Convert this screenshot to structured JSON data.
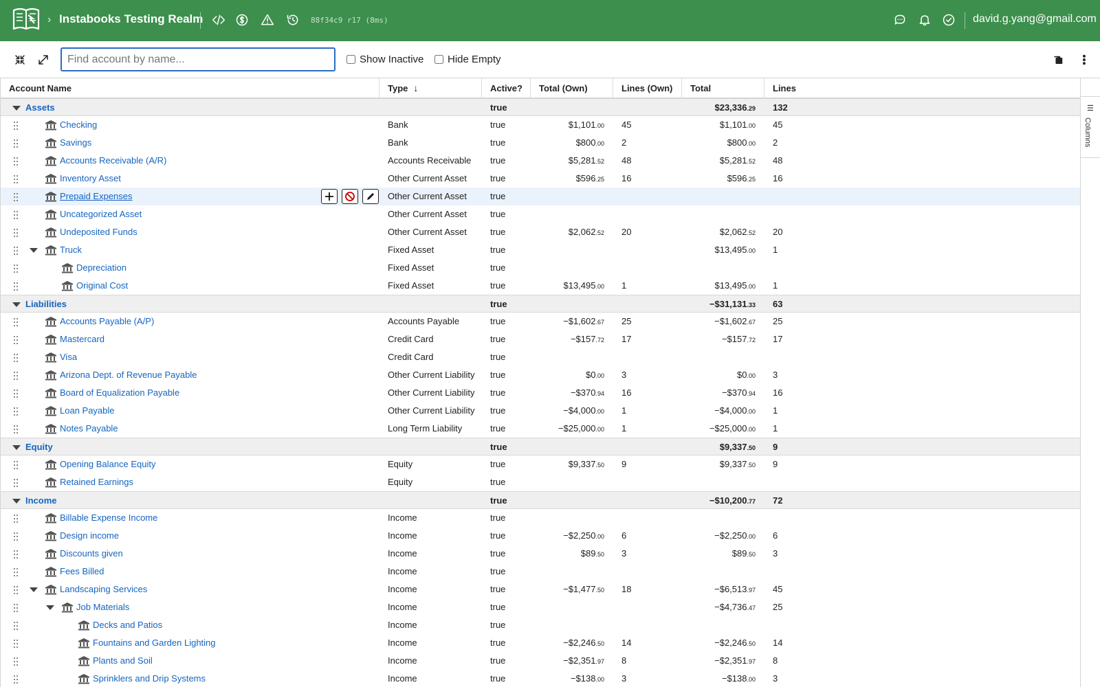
{
  "header": {
    "realm": "Instabooks Testing Realm",
    "build": "88f34c9 r17 (8ms)",
    "user": "david.g.yang@gmail.com"
  },
  "toolbar": {
    "search_placeholder": "Find account by name...",
    "show_inactive": "Show Inactive",
    "hide_empty": "Hide Empty"
  },
  "columns": [
    "Account Name",
    "Type",
    "Active?",
    "Total (Own)",
    "Lines (Own)",
    "Total",
    "Lines"
  ],
  "side_panel": {
    "columns_label": "Columns"
  },
  "rows": [
    {
      "group": true,
      "name": "Assets",
      "active": "true",
      "total_main": "$23,336",
      "total_cents": ".29",
      "lines": "132"
    },
    {
      "level": 1,
      "name": "Checking",
      "type": "Bank",
      "active": "true",
      "own_main": "$1,101",
      "own_cents": ".00",
      "lines_own": "45",
      "total_main": "$1,101",
      "total_cents": ".00",
      "lines": "45"
    },
    {
      "level": 1,
      "name": "Savings",
      "type": "Bank",
      "active": "true",
      "own_main": "$800",
      "own_cents": ".00",
      "lines_own": "2",
      "total_main": "$800",
      "total_cents": ".00",
      "lines": "2"
    },
    {
      "level": 1,
      "name": "Accounts Receivable (A/R)",
      "type": "Accounts Receivable",
      "active": "true",
      "own_main": "$5,281",
      "own_cents": ".52",
      "lines_own": "48",
      "total_main": "$5,281",
      "total_cents": ".52",
      "lines": "48"
    },
    {
      "level": 1,
      "name": "Inventory Asset",
      "type": "Other Current Asset",
      "active": "true",
      "own_main": "$596",
      "own_cents": ".25",
      "lines_own": "16",
      "total_main": "$596",
      "total_cents": ".25",
      "lines": "16"
    },
    {
      "level": 1,
      "name": "Prepaid Expenses",
      "type": "Other Current Asset",
      "active": "true",
      "hover": true
    },
    {
      "level": 1,
      "name": "Uncategorized Asset",
      "type": "Other Current Asset",
      "active": "true"
    },
    {
      "level": 1,
      "name": "Undeposited Funds",
      "type": "Other Current Asset",
      "active": "true",
      "own_main": "$2,062",
      "own_cents": ".52",
      "lines_own": "20",
      "total_main": "$2,062",
      "total_cents": ".52",
      "lines": "20"
    },
    {
      "level": 1,
      "name": "Truck",
      "type": "Fixed Asset",
      "active": "true",
      "expandable": true,
      "total_main": "$13,495",
      "total_cents": ".00",
      "lines": "1"
    },
    {
      "level": 2,
      "name": "Depreciation",
      "type": "Fixed Asset",
      "active": "true"
    },
    {
      "level": 2,
      "name": "Original Cost",
      "type": "Fixed Asset",
      "active": "true",
      "own_main": "$13,495",
      "own_cents": ".00",
      "lines_own": "1",
      "total_main": "$13,495",
      "total_cents": ".00",
      "lines": "1"
    },
    {
      "group": true,
      "name": "Liabilities",
      "active": "true",
      "total_main": "−$31,131",
      "total_cents": ".33",
      "lines": "63"
    },
    {
      "level": 1,
      "name": "Accounts Payable (A/P)",
      "type": "Accounts Payable",
      "active": "true",
      "own_main": "−$1,602",
      "own_cents": ".67",
      "lines_own": "25",
      "total_main": "−$1,602",
      "total_cents": ".67",
      "lines": "25"
    },
    {
      "level": 1,
      "name": "Mastercard",
      "type": "Credit Card",
      "active": "true",
      "own_main": "−$157",
      "own_cents": ".72",
      "lines_own": "17",
      "total_main": "−$157",
      "total_cents": ".72",
      "lines": "17"
    },
    {
      "level": 1,
      "name": "Visa",
      "type": "Credit Card",
      "active": "true"
    },
    {
      "level": 1,
      "name": "Arizona Dept. of Revenue Payable",
      "type": "Other Current Liability",
      "active": "true",
      "own_main": "$0",
      "own_cents": ".00",
      "lines_own": "3",
      "total_main": "$0",
      "total_cents": ".00",
      "lines": "3"
    },
    {
      "level": 1,
      "name": "Board of Equalization Payable",
      "type": "Other Current Liability",
      "active": "true",
      "own_main": "−$370",
      "own_cents": ".94",
      "lines_own": "16",
      "total_main": "−$370",
      "total_cents": ".94",
      "lines": "16"
    },
    {
      "level": 1,
      "name": "Loan Payable",
      "type": "Other Current Liability",
      "active": "true",
      "own_main": "−$4,000",
      "own_cents": ".00",
      "lines_own": "1",
      "total_main": "−$4,000",
      "total_cents": ".00",
      "lines": "1"
    },
    {
      "level": 1,
      "name": "Notes Payable",
      "type": "Long Term Liability",
      "active": "true",
      "own_main": "−$25,000",
      "own_cents": ".00",
      "lines_own": "1",
      "total_main": "−$25,000",
      "total_cents": ".00",
      "lines": "1"
    },
    {
      "group": true,
      "name": "Equity",
      "active": "true",
      "total_main": "$9,337",
      "total_cents": ".50",
      "lines": "9"
    },
    {
      "level": 1,
      "name": "Opening Balance Equity",
      "type": "Equity",
      "active": "true",
      "own_main": "$9,337",
      "own_cents": ".50",
      "lines_own": "9",
      "total_main": "$9,337",
      "total_cents": ".50",
      "lines": "9"
    },
    {
      "level": 1,
      "name": "Retained Earnings",
      "type": "Equity",
      "active": "true"
    },
    {
      "group": true,
      "name": "Income",
      "active": "true",
      "total_main": "−$10,200",
      "total_cents": ".77",
      "lines": "72"
    },
    {
      "level": 1,
      "name": "Billable Expense Income",
      "type": "Income",
      "active": "true"
    },
    {
      "level": 1,
      "name": "Design income",
      "type": "Income",
      "active": "true",
      "own_main": "−$2,250",
      "own_cents": ".00",
      "lines_own": "6",
      "total_main": "−$2,250",
      "total_cents": ".00",
      "lines": "6"
    },
    {
      "level": 1,
      "name": "Discounts given",
      "type": "Income",
      "active": "true",
      "own_main": "$89",
      "own_cents": ".50",
      "lines_own": "3",
      "total_main": "$89",
      "total_cents": ".50",
      "lines": "3"
    },
    {
      "level": 1,
      "name": "Fees Billed",
      "type": "Income",
      "active": "true"
    },
    {
      "level": 1,
      "name": "Landscaping Services",
      "type": "Income",
      "active": "true",
      "expandable": true,
      "own_main": "−$1,477",
      "own_cents": ".50",
      "lines_own": "18",
      "total_main": "−$6,513",
      "total_cents": ".97",
      "lines": "45"
    },
    {
      "level": 2,
      "name": "Job Materials",
      "type": "Income",
      "active": "true",
      "expandable": true,
      "total_main": "−$4,736",
      "total_cents": ".47",
      "lines": "25"
    },
    {
      "level": 3,
      "name": "Decks and Patios",
      "type": "Income",
      "active": "true"
    },
    {
      "level": 3,
      "name": "Fountains and Garden Lighting",
      "type": "Income",
      "active": "true",
      "own_main": "−$2,246",
      "own_cents": ".50",
      "lines_own": "14",
      "total_main": "−$2,246",
      "total_cents": ".50",
      "lines": "14"
    },
    {
      "level": 3,
      "name": "Plants and Soil",
      "type": "Income",
      "active": "true",
      "own_main": "−$2,351",
      "own_cents": ".97",
      "lines_own": "8",
      "total_main": "−$2,351",
      "total_cents": ".97",
      "lines": "8"
    },
    {
      "level": 3,
      "name": "Sprinklers and Drip Systems",
      "type": "Income",
      "active": "true",
      "own_main": "−$138",
      "own_cents": ".00",
      "lines_own": "3",
      "total_main": "−$138",
      "total_cents": ".00",
      "lines": "3"
    }
  ]
}
